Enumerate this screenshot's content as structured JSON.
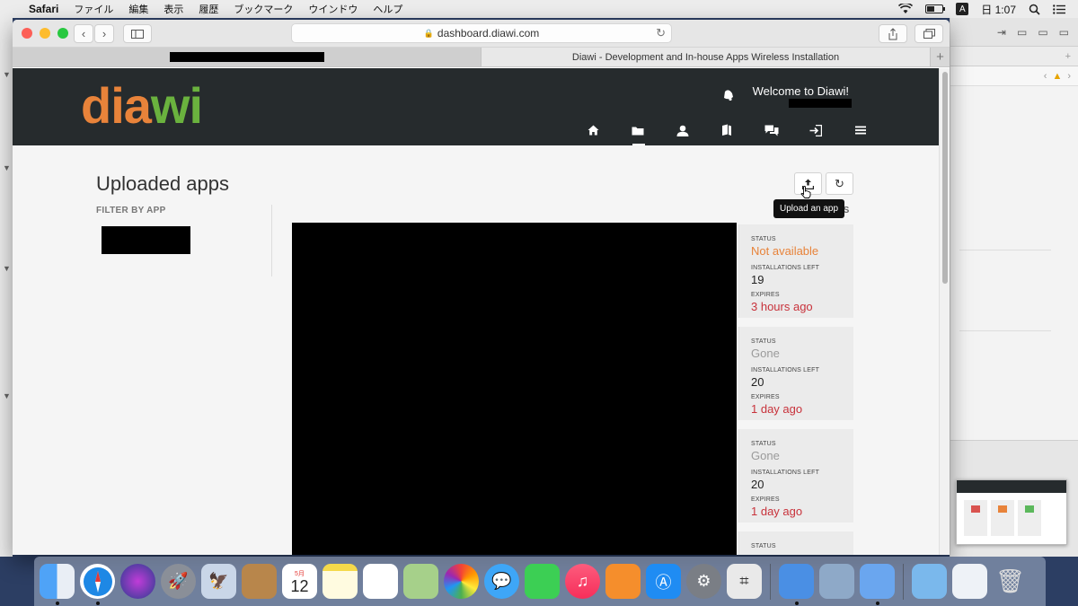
{
  "menubar": {
    "app_name": "Safari",
    "items": [
      "ファイル",
      "編集",
      "表示",
      "履歴",
      "ブックマーク",
      "ウインドウ",
      "ヘルプ"
    ],
    "input_indicator": "A",
    "clock": "日 1:07"
  },
  "browser": {
    "url": "dashboard.diawi.com",
    "tabs": [
      {
        "title": ""
      },
      {
        "title": "Diawi - Development and In-house Apps Wireless Installation"
      }
    ],
    "new_tab_label": "+"
  },
  "site": {
    "logo_part1": "dia",
    "logo_part2": "wi",
    "welcome": "Welcome to Diawi!",
    "nav": [
      "home-icon",
      "folder-icon",
      "user-icon",
      "book-icon",
      "chat-icon",
      "sign-in-icon",
      "menu-icon"
    ]
  },
  "page": {
    "title": "Uploaded apps",
    "filter_label": "FILTER BY APP",
    "apps_label": "PS",
    "upload_tooltip": "Upload an app"
  },
  "uploads": [
    {
      "status_label": "STATUS",
      "status": "Not available",
      "status_color": "#e8833a",
      "installs_label": "INSTALLATIONS LEFT",
      "installs": "19",
      "expires_label": "EXPIRES",
      "expires": "3 hours ago"
    },
    {
      "status_label": "STATUS",
      "status": "Gone",
      "status_color": "#9a9a9a",
      "installs_label": "INSTALLATIONS LEFT",
      "installs": "20",
      "expires_label": "EXPIRES",
      "expires": "1 day ago"
    },
    {
      "status_label": "STATUS",
      "status": "Gone",
      "status_color": "#9a9a9a",
      "installs_label": "INSTALLATIONS LEFT",
      "installs": "20",
      "expires_label": "EXPIRES",
      "expires": "1 day ago"
    },
    {
      "status_label": "STATUS"
    }
  ],
  "colors": {
    "header_bg": "#262b2d",
    "logo_orange": "#e8833a",
    "logo_green": "#6ab23e",
    "expired_red": "#c8323b"
  },
  "calendar_badge": {
    "month": "5月",
    "day": "12"
  }
}
